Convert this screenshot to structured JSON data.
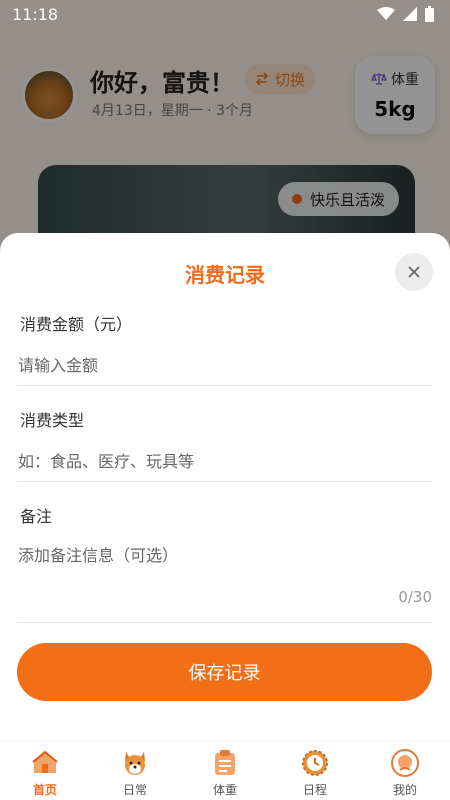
{
  "status": {
    "time": "11:18"
  },
  "header": {
    "greeting": "你好，富贵！",
    "date_line": "4月13日，星期一 · 3个月",
    "switch_label": "切换",
    "weight_label": "体重",
    "weight_value": "5kg"
  },
  "pet_card": {
    "mood": "快乐且活泼"
  },
  "sheet": {
    "title": "消费记录",
    "amount_label": "消费金额（元）",
    "amount_placeholder": "请输入金额",
    "type_label": "消费类型",
    "type_placeholder": "如：食品、医疗、玩具等",
    "note_label": "备注",
    "note_placeholder": "添加备注信息（可选）",
    "note_counter": "0/30",
    "save_label": "保存记录"
  },
  "nav": {
    "items": [
      {
        "label": "首页",
        "icon": "house-icon",
        "active": true
      },
      {
        "label": "日常",
        "icon": "corgi-icon",
        "active": false
      },
      {
        "label": "体重",
        "icon": "clipboard-icon",
        "active": false
      },
      {
        "label": "日程",
        "icon": "clock-icon",
        "active": false
      },
      {
        "label": "我的",
        "icon": "profile-icon",
        "active": false
      }
    ]
  },
  "colors": {
    "accent": "#f36f17",
    "title_orange": "#f06b1d"
  }
}
